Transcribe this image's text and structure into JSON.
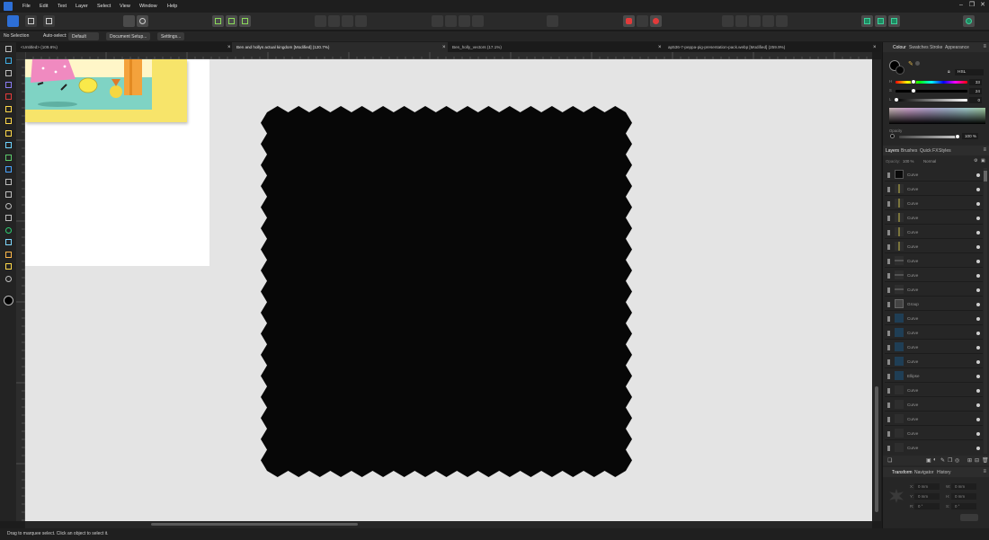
{
  "menu": [
    "File",
    "Edit",
    "Text",
    "Layer",
    "Select",
    "View",
    "Window",
    "Help"
  ],
  "context": {
    "selection": "No Selection",
    "autoselect_label": "Auto-select:",
    "autoselect_value": "Default",
    "document_setup": "Document Setup...",
    "settings": "Settings..."
  },
  "tabs": [
    {
      "label": "<Untitled> (109.6%)"
    },
    {
      "label": "Ben and hollys actual kingdom [Modified] (120.7%)"
    },
    {
      "label": "Ben_holly_vectors (17.1%)"
    },
    {
      "label": "ap536-7-peppa-pig-presentation-pack.webp [Modified] (259.9%)"
    }
  ],
  "right_panel": {
    "color_tabs": [
      "Colour",
      "Swatches",
      "Stroke",
      "Appearance"
    ],
    "color_model": "HSL",
    "hsl": {
      "h": "H",
      "s": "S",
      "l": "L",
      "h_val": "33",
      "s_val": "24",
      "l_val": "0"
    },
    "opacity_label": "Opacity",
    "opacity_value": "100 %",
    "layer_tabs": [
      "Layers",
      "Brushes",
      "Quick FX",
      "Styles"
    ],
    "layer_opacity_label": "Opacity:",
    "layer_opacity_value": "100 %",
    "blend_mode": "Normal",
    "layers": [
      {
        "name": "Curve",
        "thumb": "black"
      },
      {
        "name": "Curve",
        "thumb": "line-yellow"
      },
      {
        "name": "Curve",
        "thumb": "line-yellow"
      },
      {
        "name": "Curve",
        "thumb": "line-yellow"
      },
      {
        "name": "Curve",
        "thumb": "line-yellow"
      },
      {
        "name": "Curve",
        "thumb": "line-yellow"
      },
      {
        "name": "Curve",
        "thumb": "hline"
      },
      {
        "name": "Curve",
        "thumb": "hline"
      },
      {
        "name": "Curve",
        "thumb": "hline"
      },
      {
        "name": "Group",
        "thumb": "group"
      },
      {
        "name": "Curve",
        "thumb": "blue"
      },
      {
        "name": "Curve",
        "thumb": "blue"
      },
      {
        "name": "Curve",
        "thumb": "blue"
      },
      {
        "name": "Curve",
        "thumb": "blue"
      },
      {
        "name": "Ellipse",
        "thumb": "blue"
      },
      {
        "name": "Curve",
        "thumb": "dark"
      },
      {
        "name": "Curve",
        "thumb": "dark"
      },
      {
        "name": "Curve",
        "thumb": "dark"
      },
      {
        "name": "Curve",
        "thumb": "dark"
      },
      {
        "name": "Curve",
        "thumb": "dark"
      }
    ],
    "transform_tabs": [
      "Transform",
      "Navigator",
      "History"
    ],
    "transform": {
      "x_label": "X:",
      "x_val": "0 mm",
      "y_label": "Y:",
      "y_val": "0 mm",
      "w_label": "W:",
      "w_val": "0 mm",
      "h_label": "H:",
      "h_val": "0 mm",
      "r_label": "R:",
      "r_val": "0 °",
      "s_label": "S:",
      "s_val": "0 °"
    }
  },
  "status": {
    "text": "Drag to marquee select. Click an object to select it."
  },
  "colors": {
    "accent": "#2d6fd6",
    "shape": "#070707",
    "canvas": "#e4e4e4"
  },
  "icons": [
    "affinity-logo",
    "minimize-icon",
    "restore-icon",
    "close-icon"
  ]
}
